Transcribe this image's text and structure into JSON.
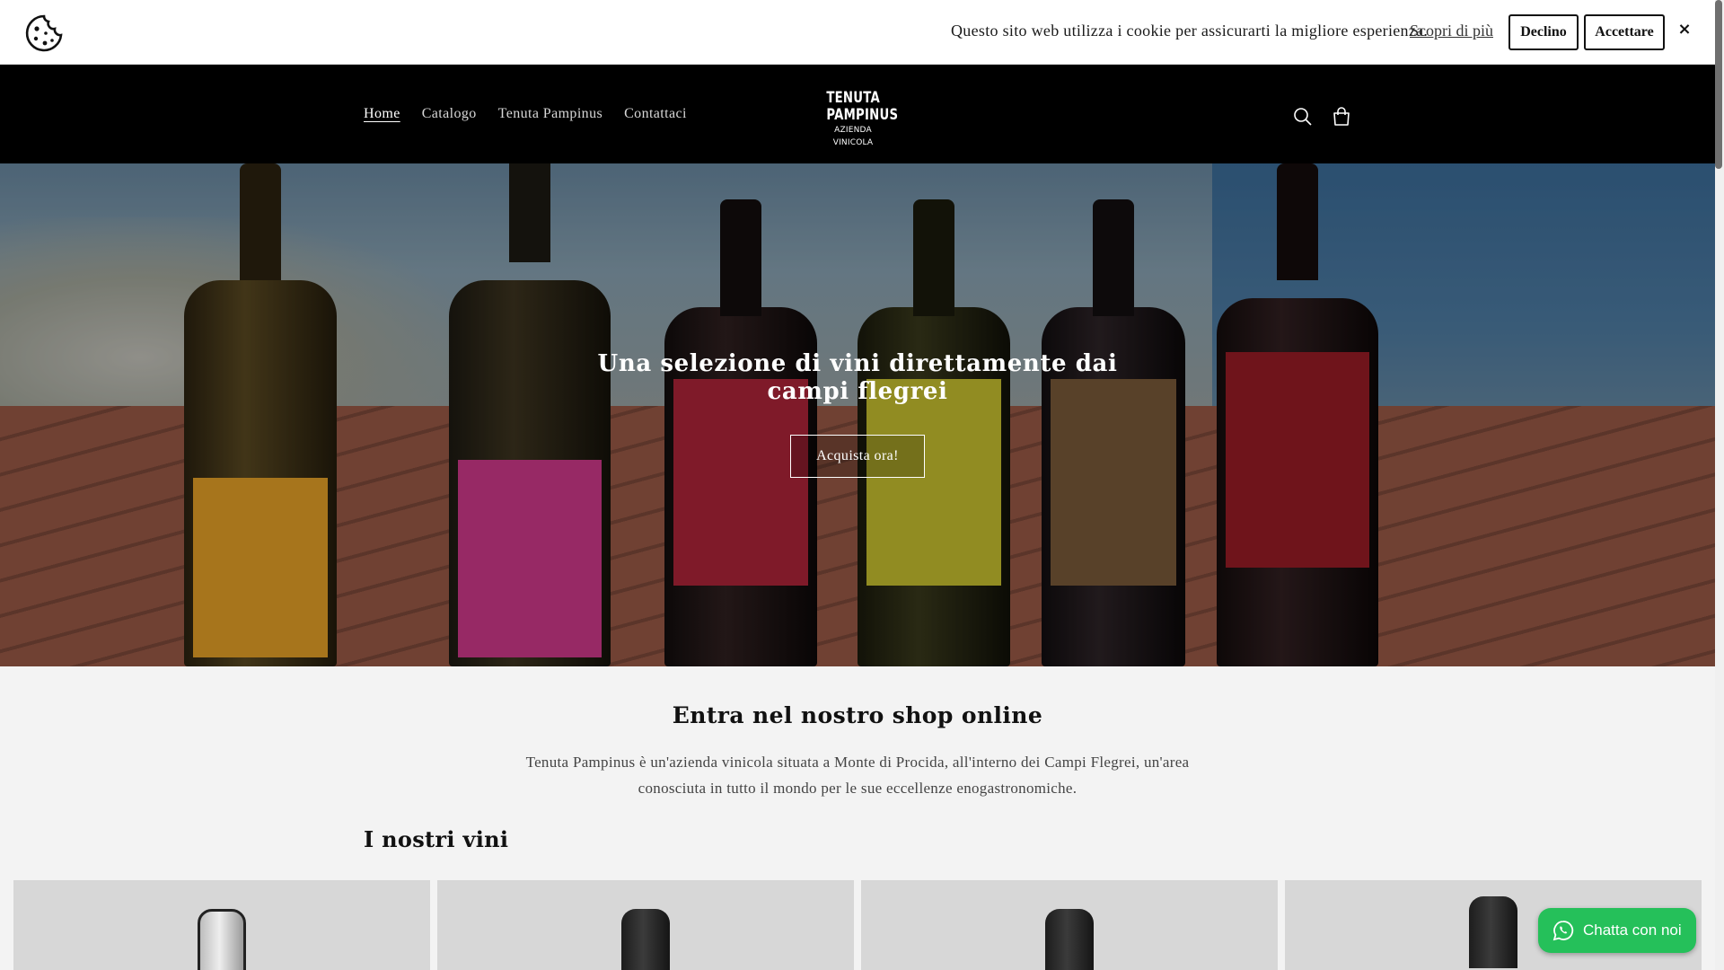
{
  "cookie_bar": {
    "message": "Questo sito web utilizza i cookie per assicurarti la migliore esperienza.",
    "learn_more": "Scopri di più",
    "decline_label": "Declino",
    "accept_label": "Accettare",
    "close_label": "×",
    "icon": "cookie-icon"
  },
  "header": {
    "nav": [
      {
        "label": "Home",
        "active": true
      },
      {
        "label": "Catalogo",
        "active": false
      },
      {
        "label": "Tenuta Pampinus",
        "active": false
      },
      {
        "label": "Contattaci",
        "active": false
      }
    ],
    "logo": {
      "line1": "TENUTA",
      "line2": "PAMPINUS",
      "line3": "AZIENDA VINICOLA"
    },
    "icons": [
      "search-icon",
      "cart-icon"
    ]
  },
  "hero": {
    "title": "Una selezione di vini direttamente dai campi flegrei",
    "cta_label": "Acquista ora!"
  },
  "intro": {
    "title": "Entra nel nostro shop online",
    "text": "Tenuta Pampinus è un'azienda vinicola situata a Monte di Procida, all'interno dei Campi Flegrei, un'area conosciuta in tutto il mondo per le sue eccellenze enogastronomiche."
  },
  "wines": {
    "title": "I nostri vini"
  },
  "chat": {
    "label": "Chatta con noi",
    "icon": "whatsapp-icon",
    "color": "#25c05a"
  },
  "colors": {
    "header_bg": "#000000",
    "page_bg": "#f3f3f3"
  }
}
